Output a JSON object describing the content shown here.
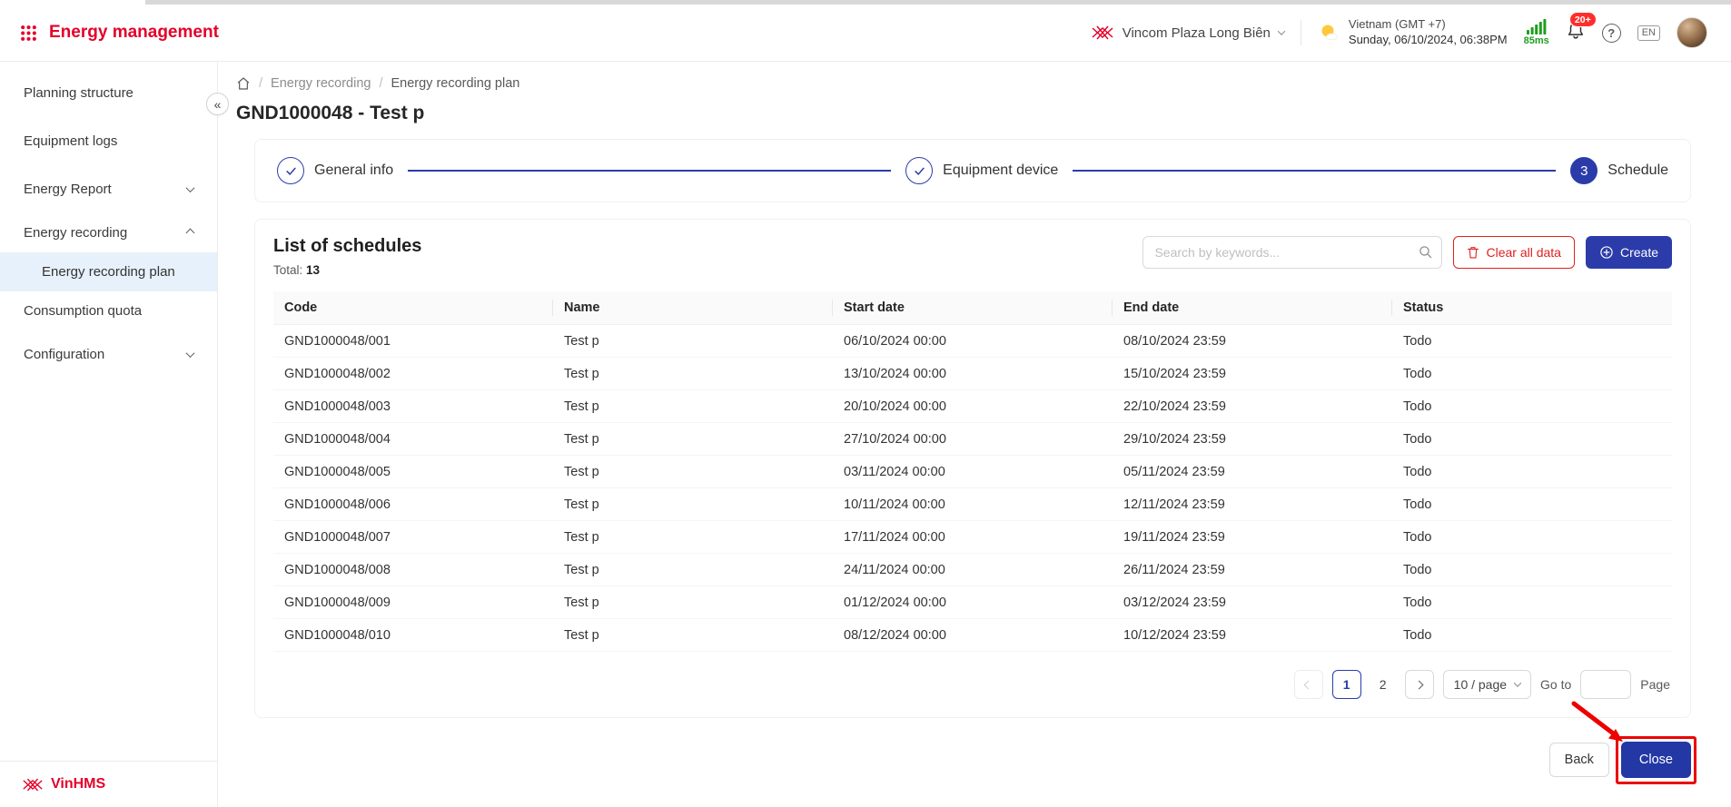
{
  "colors": {
    "primary": "#2b3caa",
    "brand_red": "#e4002b",
    "danger": "#e02020",
    "success_green": "#1f9d1f",
    "annotation_red": "#ec0000",
    "active_nav_bg": "#e7f1fb"
  },
  "header": {
    "app_title": "Energy management",
    "site": "Vincom Plaza Long Biên",
    "tz1": "Vietnam (GMT +7)",
    "tz2": "Sunday, 06/10/2024, 06:38PM",
    "latency": "85ms",
    "badge": "20+",
    "lang": "EN"
  },
  "sidebar": {
    "items": [
      {
        "label": "Planning structure"
      },
      {
        "label": "Equipment logs"
      },
      {
        "label": "Energy Report"
      },
      {
        "label": "Energy recording"
      },
      {
        "label": "Energy recording plan"
      },
      {
        "label": "Consumption quota"
      },
      {
        "label": "Configuration"
      }
    ],
    "brand": "VinHMS"
  },
  "breadcrumb": {
    "items": [
      "Energy recording",
      "Energy recording plan"
    ]
  },
  "page": {
    "title": "GND1000048 - Test p"
  },
  "stepper": {
    "steps": [
      {
        "label": "General info",
        "state": "done"
      },
      {
        "label": "Equipment device",
        "state": "done"
      },
      {
        "label": "Schedule",
        "state": "active",
        "number": "3"
      }
    ]
  },
  "schedules": {
    "title": "List of schedules",
    "total_label": "Total:",
    "total": "13",
    "search_placeholder": "Search by keywords...",
    "clear_label": "Clear all data",
    "create_label": "Create",
    "columns": [
      "Code",
      "Name",
      "Start date",
      "End date",
      "Status"
    ],
    "rows": [
      {
        "code": "GND1000048/001",
        "name": "Test p",
        "start": "06/10/2024 00:00",
        "end": "08/10/2024 23:59",
        "status": "Todo"
      },
      {
        "code": "GND1000048/002",
        "name": "Test p",
        "start": "13/10/2024 00:00",
        "end": "15/10/2024 23:59",
        "status": "Todo"
      },
      {
        "code": "GND1000048/003",
        "name": "Test p",
        "start": "20/10/2024 00:00",
        "end": "22/10/2024 23:59",
        "status": "Todo"
      },
      {
        "code": "GND1000048/004",
        "name": "Test p",
        "start": "27/10/2024 00:00",
        "end": "29/10/2024 23:59",
        "status": "Todo"
      },
      {
        "code": "GND1000048/005",
        "name": "Test p",
        "start": "03/11/2024 00:00",
        "end": "05/11/2024 23:59",
        "status": "Todo"
      },
      {
        "code": "GND1000048/006",
        "name": "Test p",
        "start": "10/11/2024 00:00",
        "end": "12/11/2024 23:59",
        "status": "Todo"
      },
      {
        "code": "GND1000048/007",
        "name": "Test p",
        "start": "17/11/2024 00:00",
        "end": "19/11/2024 23:59",
        "status": "Todo"
      },
      {
        "code": "GND1000048/008",
        "name": "Test p",
        "start": "24/11/2024 00:00",
        "end": "26/11/2024 23:59",
        "status": "Todo"
      },
      {
        "code": "GND1000048/009",
        "name": "Test p",
        "start": "01/12/2024 00:00",
        "end": "03/12/2024 23:59",
        "status": "Todo"
      },
      {
        "code": "GND1000048/010",
        "name": "Test p",
        "start": "08/12/2024 00:00",
        "end": "10/12/2024 23:59",
        "status": "Todo"
      }
    ]
  },
  "pagination": {
    "pages": [
      "1",
      "2"
    ],
    "current": "1",
    "size_label": "10 / page",
    "goto_label": "Go to",
    "page_label": "Page"
  },
  "footer": {
    "back": "Back",
    "close": "Close"
  }
}
